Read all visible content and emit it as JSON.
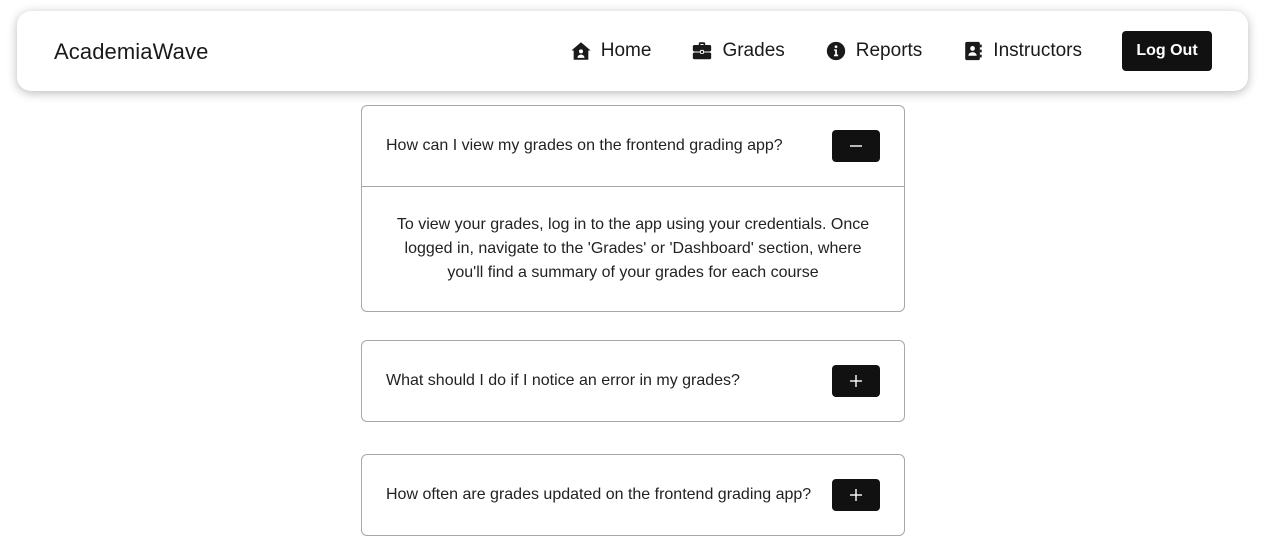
{
  "navbar": {
    "brand": "AcademiaWave",
    "links": [
      {
        "label": "Home",
        "icon": "home-icon"
      },
      {
        "label": "Grades",
        "icon": "briefcase-icon"
      },
      {
        "label": "Reports",
        "icon": "info-circle-icon"
      },
      {
        "label": "Instructors",
        "icon": "contact-book-icon"
      }
    ],
    "logout_label": "Log Out"
  },
  "faqs": [
    {
      "question": "How can I view my grades on the frontend grading app?",
      "expanded": true,
      "toggle_icon": "minus-icon",
      "answer": "To view your grades, log in to the app using your credentials. Once logged in, navigate to the 'Grades' or 'Dashboard' section, where you'll find a summary of your grades for each course"
    },
    {
      "question": "What should I do if I notice an error in my grades?",
      "expanded": false,
      "toggle_icon": "plus-icon"
    },
    {
      "question": "How often are grades updated on the frontend grading app?",
      "expanded": false,
      "toggle_icon": "plus-icon"
    }
  ],
  "colors": {
    "button_bg": "#111111",
    "border": "#a8a8a8",
    "text": "#222222"
  }
}
